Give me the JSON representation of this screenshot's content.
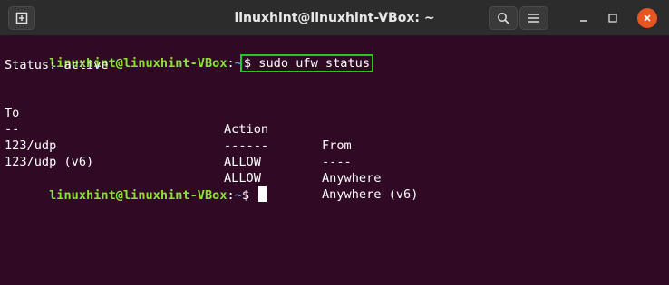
{
  "titlebar": {
    "title": "linuxhint@linuxhint-VBox: ~",
    "new_tab_icon": "new-tab-icon",
    "search_icon": "search-icon",
    "menu_icon": "hamburger-menu-icon",
    "minimize_icon": "minimize-icon",
    "maximize_icon": "maximize-icon",
    "close_icon": "close-icon",
    "close_color": "#e95420"
  },
  "terminal": {
    "background": "#300a24",
    "prompt_user_host": "linuxhint@linuxhint-VBox",
    "prompt_sep": ":",
    "prompt_path": "~",
    "command_text": "$ sudo ufw status",
    "highlight_color": "#22c91e",
    "status_line": "Status: active",
    "table": {
      "headers": [
        "To",
        "Action",
        "From"
      ],
      "separators": [
        "--",
        "------",
        "----"
      ],
      "rows": [
        [
          "123/udp",
          "ALLOW",
          "Anywhere"
        ],
        [
          "123/udp (v6)",
          "ALLOW",
          "Anywhere (v6)"
        ]
      ]
    },
    "prompt2_dollar": "$"
  }
}
